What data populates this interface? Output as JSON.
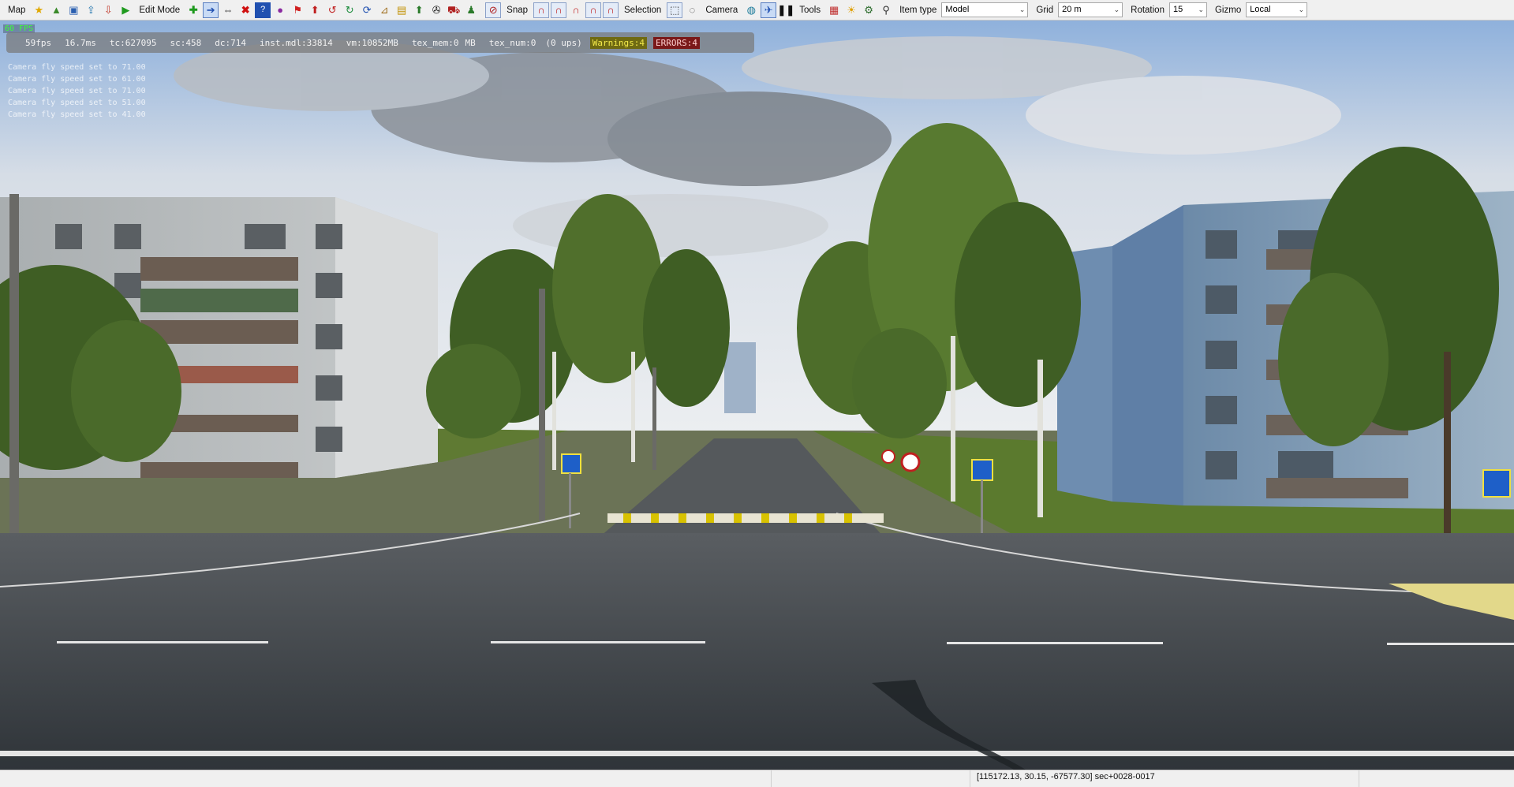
{
  "toolbar": {
    "map_label": "Map",
    "edit_mode_label": "Edit Mode",
    "snap_label": "Snap",
    "selection_label": "Selection",
    "camera_label": "Camera",
    "tools_label": "Tools",
    "item_type_label": "Item type",
    "item_type_value": "Model",
    "grid_label": "Grid",
    "grid_value": "20 m",
    "rotation_label": "Rotation",
    "rotation_value": "15",
    "gizmo_label": "Gizmo",
    "gizmo_value": "Local"
  },
  "overlay": {
    "fps_badge": "60 FPS",
    "stats": {
      "fps": "59fps",
      "frame_time": "16.7ms",
      "tc": "tc:627095",
      "sc": "sc:458",
      "dc": "dc:714",
      "inst": "inst.mdl:33814",
      "vm": "vm:10852MB",
      "tex_mem": "tex_mem:0",
      "tex_mem_unit": "MB",
      "tex_num": "tex_num:0",
      "ups": "(0 ups)",
      "warnings": "Warnings:4",
      "errors": "ERRORS:4"
    },
    "log": [
      "Camera fly speed set to 71.00",
      "Camera fly speed set to 61.00",
      "Camera fly speed set to 71.00",
      "Camera fly speed set to 51.00",
      "Camera fly speed set to 41.00"
    ]
  },
  "statusbar": {
    "coordinates": "[115172.13, 30.15, -67577.30] sec+0028-0017"
  },
  "colors": {
    "toolbar_bg": "#f0f0f0",
    "sky_top": "#7fa6d6",
    "asphalt": "#3a3f44",
    "grass": "#5b7a2e",
    "warnings_bg": "#6f6a12",
    "errors_bg": "#7a1818"
  }
}
